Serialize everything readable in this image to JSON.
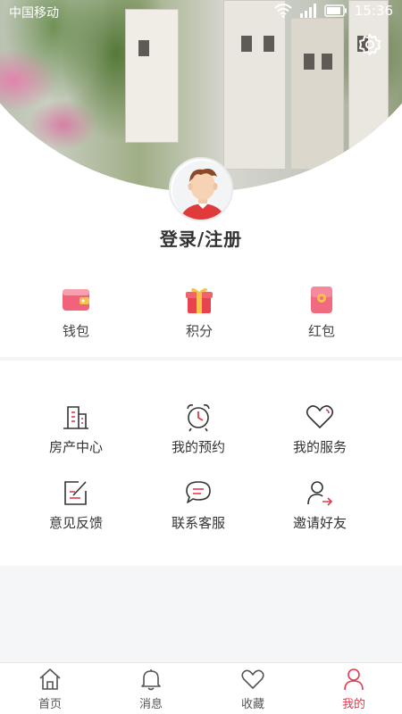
{
  "status_bar": {
    "carrier": "中国移动",
    "time": "15:36"
  },
  "header": {
    "icons": [
      "gear-icon"
    ]
  },
  "profile": {
    "login_label": "登录/注册",
    "avatar": "default-avatar"
  },
  "quick_actions": [
    {
      "label": "钱包",
      "icon": "wallet-icon"
    },
    {
      "label": "积分",
      "icon": "gift-icon"
    },
    {
      "label": "红包",
      "icon": "red-envelope-icon"
    }
  ],
  "services": [
    {
      "label": "房产中心",
      "icon": "building-icon"
    },
    {
      "label": "我的预约",
      "icon": "alarm-clock-icon"
    },
    {
      "label": "我的服务",
      "icon": "heart-icon"
    },
    {
      "label": "意见反馈",
      "icon": "edit-icon"
    },
    {
      "label": "联系客服",
      "icon": "chat-icon"
    },
    {
      "label": "邀请好友",
      "icon": "invite-user-icon"
    }
  ],
  "tabbar": {
    "active": "我的",
    "accent_color": "#e03a4e",
    "tabs": [
      {
        "label": "首页",
        "icon": "home-icon"
      },
      {
        "label": "消息",
        "icon": "bell-icon"
      },
      {
        "label": "收藏",
        "icon": "heart-icon"
      },
      {
        "label": "我的",
        "icon": "user-icon"
      }
    ]
  },
  "colors": {
    "accent": "#e03a4e",
    "wallet": "#f0637a",
    "gift": "#e8444f",
    "red_envelope": "#f06a80"
  }
}
